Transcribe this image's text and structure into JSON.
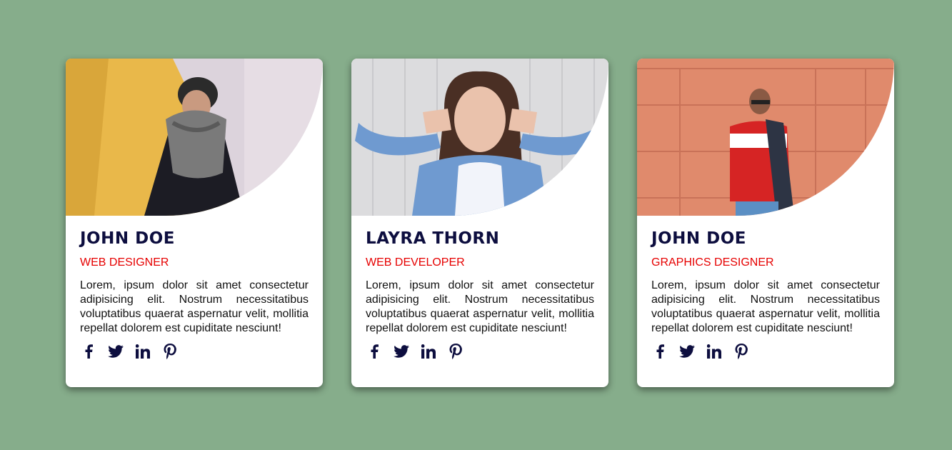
{
  "cards": [
    {
      "name": "JOHN DOE",
      "role": "WEB DESIGNER",
      "description": "Lorem, ipsum dolor sit amet consectetur adipisicing elit. Nostrum necessitatibus voluptatibus quaerat aspernatur velit, mollitia repellat dolorem est cupiditate nesciunt!",
      "social_icons": [
        "facebook-icon",
        "twitter-icon",
        "linkedin-icon",
        "pinterest-icon"
      ]
    },
    {
      "name": "LAYRA THORN",
      "role": "WEB DEVELOPER",
      "description": "Lorem, ipsum dolor sit amet consectetur adipisicing elit. Nostrum necessitatibus voluptatibus quaerat aspernatur velit, mollitia repellat dolorem est cupiditate nesciunt!",
      "social_icons": [
        "facebook-icon",
        "twitter-icon",
        "linkedin-icon",
        "pinterest-icon"
      ]
    },
    {
      "name": "JOHN DOE",
      "role": "GRAPHICS DESIGNER",
      "description": "Lorem, ipsum dolor sit amet consectetur adipisicing elit. Nostrum necessitatibus voluptatibus quaerat aspernatur velit, mollitia repellat dolorem est cupiditate nesciunt!",
      "social_icons": [
        "facebook-icon",
        "twitter-icon",
        "linkedin-icon",
        "pinterest-icon"
      ]
    }
  ],
  "colors": {
    "background": "#86ad8b",
    "card": "#ffffff",
    "name": "#0d0e3f",
    "role": "#e60000",
    "icon": "#0d0e3f"
  }
}
